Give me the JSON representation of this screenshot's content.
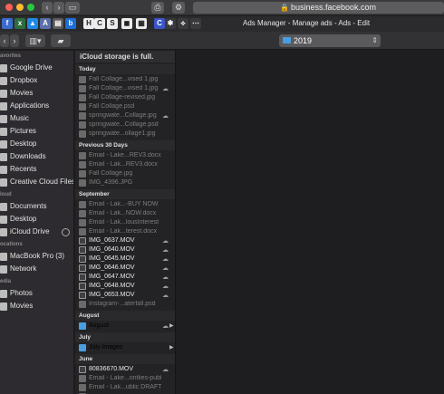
{
  "browser": {
    "url": "business.facebook.com",
    "tab_title": "Ads Manager - Manage ads - Ads - Edit",
    "tab_icons": [
      {
        "icon": "f-icon",
        "glyph": "f",
        "color": "#3a6bd1"
      },
      {
        "icon": "x-icon",
        "glyph": "x",
        "color": "#2d6e3e"
      },
      {
        "icon": "drive-icon",
        "glyph": "▲",
        "color": "#1e88e5"
      },
      {
        "icon": "ap-icon",
        "glyph": "A",
        "color": "#5a6fa8"
      },
      {
        "icon": "doc-icon",
        "glyph": "▤",
        "color": "#5a5a5a"
      },
      {
        "icon": "b-icon",
        "glyph": "b",
        "color": "#1b6fd6"
      },
      {
        "icon": "h-icon",
        "glyph": "H",
        "color": "#ececec"
      },
      {
        "icon": "c-icon",
        "glyph": "C",
        "color": "#ececec"
      },
      {
        "icon": "s-icon",
        "glyph": "S",
        "color": "#ececec"
      },
      {
        "icon": "chat-icon",
        "glyph": "◼",
        "color": "#ececec"
      },
      {
        "icon": "bars-icon",
        "glyph": "▦",
        "color": "#ececec"
      },
      {
        "icon": "c2-icon",
        "glyph": "C",
        "color": "#3a55c8"
      },
      {
        "icon": "star-icon",
        "glyph": "✱",
        "color": "#3a3a3c"
      },
      {
        "icon": "pin-icon",
        "glyph": "⟡",
        "color": "#3a3a3c"
      },
      {
        "icon": "dots-icon",
        "glyph": "⋯",
        "color": "#3a3a3c"
      }
    ]
  },
  "toolbar": {
    "path_label": "2019"
  },
  "sidebar": {
    "sections": [
      {
        "header": "avorites",
        "items": [
          "Google Drive",
          "Dropbox",
          "Movies",
          "Applications",
          "Music",
          "Pictures",
          "Desktop",
          "Downloads",
          "Recents",
          "Creative Cloud Files"
        ]
      },
      {
        "header": "loud",
        "items": [
          "Documents",
          "Desktop",
          "iCloud Drive"
        ]
      },
      {
        "header": "ocations",
        "items": [
          "MacBook Pro (3)",
          "Network"
        ]
      },
      {
        "header": "edia",
        "items": [
          "Photos",
          "Movies"
        ]
      }
    ]
  },
  "column": {
    "banner": "iCloud storage is full.",
    "sections": [
      {
        "header": "Today",
        "rows": [
          {
            "name": "Fall Collage...vised 1.jpg",
            "style": "dim"
          },
          {
            "name": "Fall Collage...vised 1.jpg",
            "style": "dim",
            "cloud": true
          },
          {
            "name": "Fall Collage-revised.jpg",
            "style": "dim"
          },
          {
            "name": "Fall Collage.psd",
            "style": "dim"
          },
          {
            "name": "springwate...Collage.jpg",
            "style": "dim",
            "cloud": true
          },
          {
            "name": "springwate...Collage.psd",
            "style": "dim"
          },
          {
            "name": "springwate...ollage1.jpg",
            "style": "dim"
          }
        ]
      },
      {
        "header": "Previous 30 Days",
        "rows": [
          {
            "name": "Email - Lake...REV3.docx",
            "style": "dim"
          },
          {
            "name": "Email - Lak...REV3.docx",
            "style": "dim"
          },
          {
            "name": "Fall Collage.jpg",
            "style": "dim"
          },
          {
            "name": "IMG_4396.JPG",
            "style": "dim"
          }
        ]
      },
      {
        "header": "September",
        "rows": [
          {
            "name": "Email - Lak...-BUY NOW",
            "style": "dim"
          },
          {
            "name": "Email - Lak...NOW.docx",
            "style": "dim"
          },
          {
            "name": "Email - Lak...lousInterest",
            "style": "dim"
          },
          {
            "name": "Email - Lak...terest.docx",
            "style": "dim"
          },
          {
            "name": "IMG_0637.MOV",
            "style": "bright",
            "cloud": true
          },
          {
            "name": "IMG_0640.MOV",
            "style": "bright",
            "cloud": true
          },
          {
            "name": "IMG_0645.MOV",
            "style": "bright",
            "cloud": true
          },
          {
            "name": "IMG_0646.MOV",
            "style": "bright",
            "cloud": true
          },
          {
            "name": "IMG_0647.MOV",
            "style": "bright",
            "cloud": true
          },
          {
            "name": "IMG_0648.MOV",
            "style": "bright",
            "cloud": true
          },
          {
            "name": "IMG_0653.MOV",
            "style": "bright",
            "cloud": true
          },
          {
            "name": "Instagram-...aterfall.psd",
            "style": "dim"
          }
        ]
      },
      {
        "header": "August",
        "rows": [
          {
            "name": "August",
            "style": "folder",
            "cloud": true,
            "chevron": true
          }
        ]
      },
      {
        "header": "July",
        "rows": [
          {
            "name": "July Images",
            "style": "folder",
            "chevron": true
          }
        ]
      },
      {
        "header": "June",
        "rows": [
          {
            "name": "80836670.MOV",
            "style": "bright",
            "cloud": true
          },
          {
            "name": "Email - Lake...ontlies-public",
            "style": "dim"
          },
          {
            "name": "Email - Lak...ublic DRAFT B",
            "style": "dim"
          },
          {
            "name": "",
            "style": "dim"
          }
        ]
      }
    ]
  }
}
